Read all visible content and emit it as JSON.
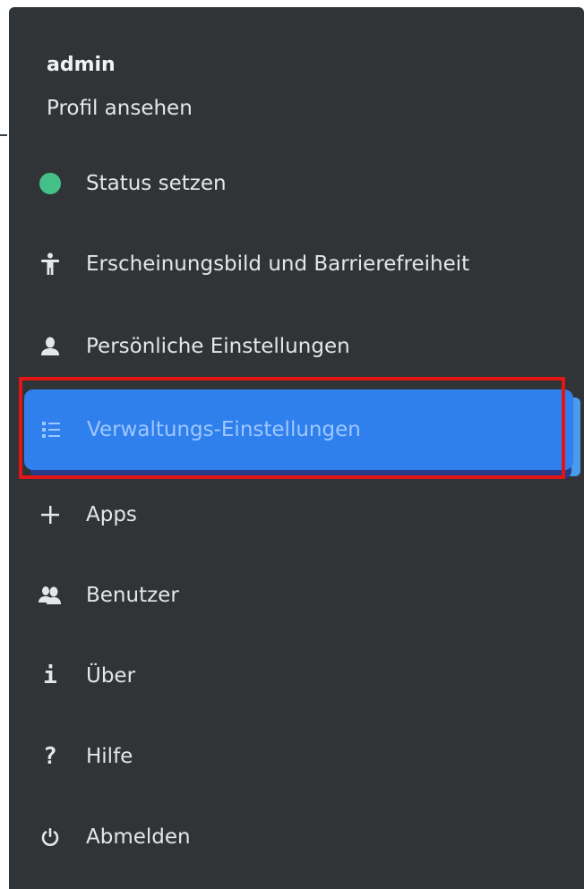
{
  "profile": {
    "name": "admin",
    "link": "Profil ansehen"
  },
  "menu": {
    "items": [
      {
        "id": "status",
        "label": "Status setzen",
        "icon": "status-dot-icon"
      },
      {
        "id": "appearance",
        "label": "Erscheinungsbild und Barrierefreiheit",
        "icon": "accessibility-icon"
      },
      {
        "id": "personal",
        "label": "Persönliche Einstellungen",
        "icon": "user-icon"
      },
      {
        "id": "admin",
        "label": "Verwaltungs-Einstellungen",
        "icon": "list-icon",
        "active": true
      },
      {
        "id": "apps",
        "label": "Apps",
        "icon": "plus-icon"
      },
      {
        "id": "users",
        "label": "Benutzer",
        "icon": "users-icon"
      },
      {
        "id": "about",
        "label": "Über",
        "icon": "info-icon"
      },
      {
        "id": "help",
        "label": "Hilfe",
        "icon": "help-icon"
      },
      {
        "id": "logout",
        "label": "Abmelden",
        "icon": "power-icon"
      }
    ]
  },
  "colors": {
    "background": "#313437",
    "active": "#2f80ed",
    "active_text": "#9fc7ff",
    "status_online": "#45c088",
    "highlight": "#e11515"
  }
}
